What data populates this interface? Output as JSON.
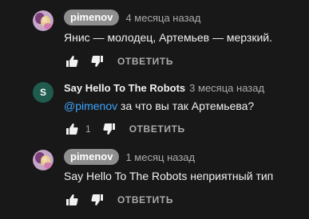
{
  "comments": [
    {
      "author": "pimenov",
      "time": "4 месяца назад",
      "text": "Янис — молодец, Артемьев — мерзкий.",
      "likes": "",
      "reply_label": "ОТВЕТИТЬ"
    },
    {
      "author": "Say Hello To The Robots",
      "avatar_letter": "S",
      "time": "3 месяца назад",
      "mention": "@pimenov",
      "text": " за что вы так Артемьева?",
      "likes": "1",
      "reply_label": "ОТВЕТИТЬ"
    },
    {
      "author": "pimenov",
      "time": "1 месяц назад",
      "text": "Say Hello To The Robots неприятный тип",
      "likes": "",
      "reply_label": "ОТВЕТИТЬ"
    }
  ],
  "icons": {
    "like": "thumbs-up-icon",
    "dislike": "thumbs-down-icon"
  }
}
